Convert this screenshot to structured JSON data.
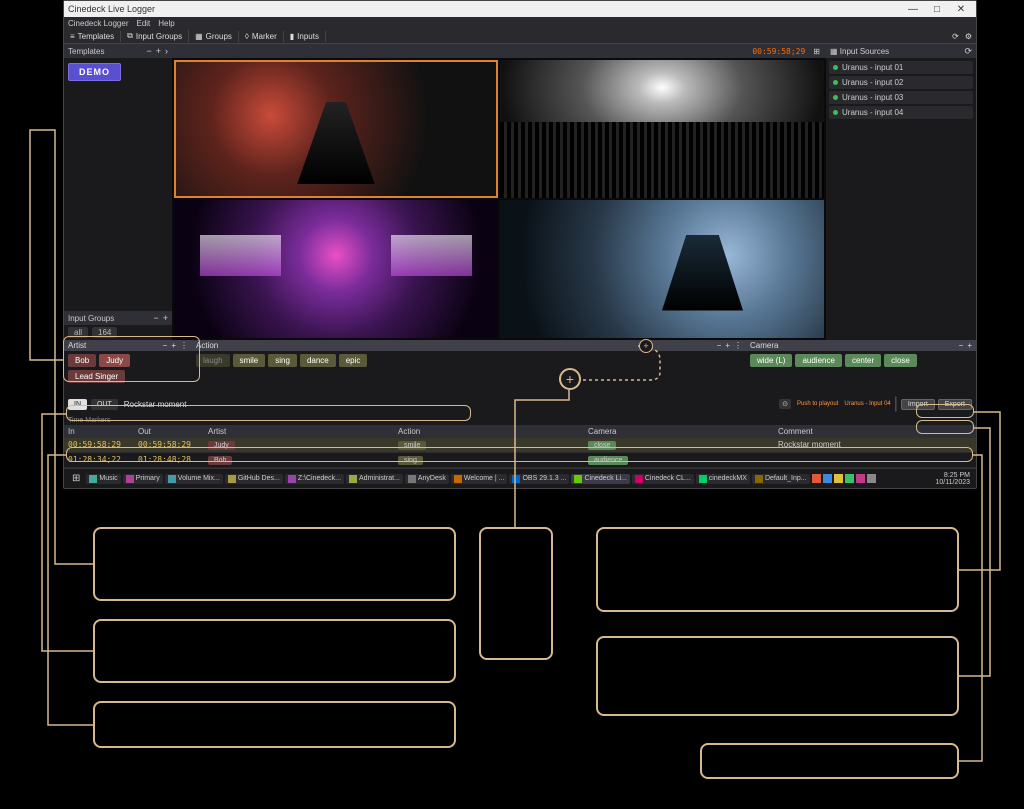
{
  "window": {
    "title": "Cinedeck Live Logger",
    "min": "—",
    "max": "□",
    "close": "✕"
  },
  "menubar": {
    "items": [
      "Cinedeck Logger",
      "Edit",
      "Help"
    ]
  },
  "toolbar": {
    "templates": "Templates",
    "inputGroups": "Input Groups",
    "groups": "Groups",
    "marker": "Marker",
    "inputs": "Inputs"
  },
  "panels": {
    "templatesTitle": "Templates",
    "demoLabel": "DEMO",
    "inputGroupsTitle": "Input Groups",
    "ig_all": "all",
    "ig_164": "164",
    "inputSourcesTitle": "Input Sources"
  },
  "timecode": "00:59:58;29",
  "sources": [
    {
      "label": "Uranus - input 01"
    },
    {
      "label": "Uranus - input 02"
    },
    {
      "label": "Uranus - input 03"
    },
    {
      "label": "Uranus - input 04"
    }
  ],
  "tagGroups": {
    "artist": {
      "title": "Artist",
      "tags": [
        {
          "label": "Bob",
          "cls": "maroon"
        },
        {
          "label": "Judy",
          "cls": "maroon sel"
        },
        {
          "label": "Lead Singer",
          "cls": "maroon"
        }
      ]
    },
    "action": {
      "title": "Action",
      "tags": [
        {
          "label": "laugh",
          "cls": "olive dim"
        },
        {
          "label": "smile",
          "cls": "olive"
        },
        {
          "label": "sing",
          "cls": "olive"
        },
        {
          "label": "dance",
          "cls": "olive"
        },
        {
          "label": "epic",
          "cls": "olive"
        }
      ]
    },
    "camera": {
      "title": "Camera",
      "tags": [
        {
          "label": "wide (L)",
          "cls": "green"
        },
        {
          "label": "audience",
          "cls": "green"
        },
        {
          "label": "center",
          "cls": "green"
        },
        {
          "label": "close",
          "cls": "green"
        }
      ]
    }
  },
  "markerBar": {
    "in": "IN",
    "out": "OUT",
    "comment": "Rockstar moment",
    "pushLabel": "Push to playout",
    "target": "Uranus - Input 04",
    "import": "Import",
    "export": "Export"
  },
  "markersTable": {
    "title": "Time Markers",
    "headers": {
      "in": "In",
      "out": "Out",
      "artist": "Artist",
      "action": "Action",
      "camera": "Camera",
      "comment": "Comment"
    },
    "rows": [
      {
        "in": "00:59:58;29",
        "out": "00:59:58;29",
        "artist": "Judy",
        "action": "smile",
        "camera": "close",
        "comment": "Rockstar moment",
        "sel": true
      },
      {
        "in": "01:28:34;22",
        "out": "01:28:48;28",
        "artist": "Bob",
        "action": "sing",
        "camera": "audience",
        "comment": "",
        "sel": false
      }
    ]
  },
  "taskbar": {
    "items": [
      "Music",
      "Primary",
      "Volume Mix...",
      "GitHub Des...",
      "Z:\\Cinedeck...",
      "Administrat...",
      "AnyDesk",
      "Welcome | ...",
      "OBS 29.1.3 ...",
      "Cinedeck Li...",
      "Cinedeck CL...",
      "cinedeckMX",
      "Default_Inp..."
    ],
    "time": "8:25 PM",
    "date": "10/11/2023"
  }
}
